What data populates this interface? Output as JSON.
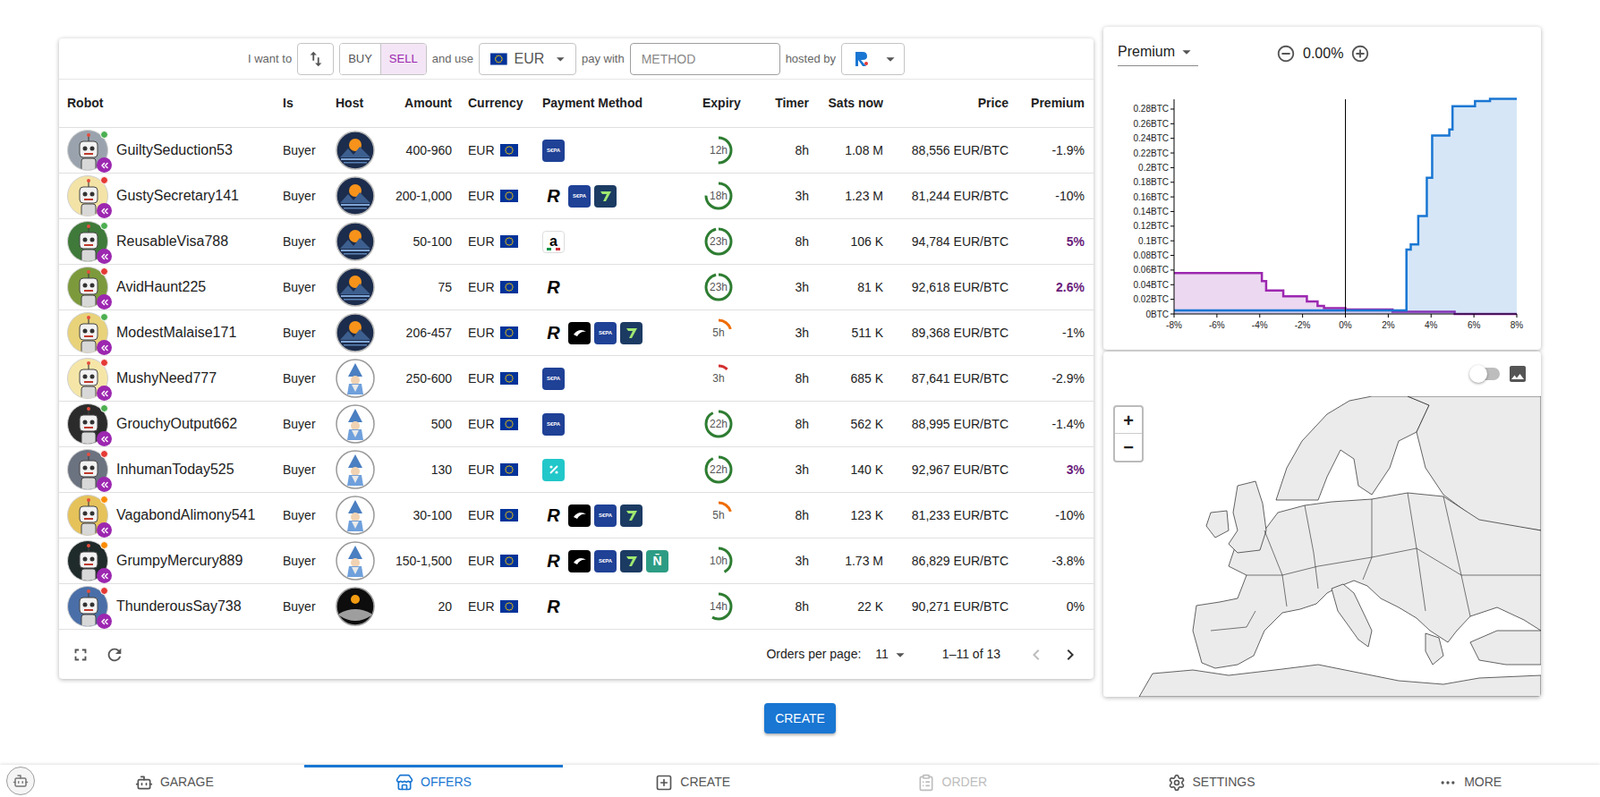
{
  "toolbar": {
    "want_label": "I want to",
    "side": [
      {
        "label": "BUY",
        "selected": false
      },
      {
        "label": "SELL",
        "selected": true
      }
    ],
    "use_label": "and use",
    "currency": "EUR",
    "pay_label": "pay with",
    "method_placeholder": "METHOD",
    "host_label": "hosted by"
  },
  "table": {
    "columns": [
      "Robot",
      "Is",
      "Host",
      "Amount",
      "Currency",
      "Payment Method",
      "Expiry",
      "Timer",
      "Sats now",
      "Price",
      "Premium"
    ],
    "rows": [
      {
        "robot": "GuiltySeduction53",
        "avatar_color": "#9aa3ad",
        "status_color": "#4caf50",
        "is": "Buyer",
        "host": "mountain",
        "amount": "400-960",
        "currency": "EUR",
        "methods": [
          {
            "kind": "sepa",
            "glyph": "S€PA"
          }
        ],
        "expiry": {
          "text": "12h",
          "level": 0.5,
          "color": "#2e7d32"
        },
        "timer": "8h",
        "sats": "1.08 M",
        "price": "88,556 EUR/BTC",
        "premium": {
          "text": "-1.9%",
          "highlight": false
        }
      },
      {
        "robot": "GustySecretary141",
        "avatar_color": "#f3e3a6",
        "status_color": "#e53935",
        "is": "Buyer",
        "host": "mountain",
        "amount": "200-1,000",
        "currency": "EUR",
        "methods": [
          {
            "kind": "revolut",
            "glyph": "R"
          },
          {
            "kind": "sepa",
            "glyph": "S€PA"
          },
          {
            "kind": "wise"
          }
        ],
        "expiry": {
          "text": "18h",
          "level": 0.75,
          "color": "#2e7d32"
        },
        "timer": "3h",
        "sats": "1.23 M",
        "price": "81,244 EUR/BTC",
        "premium": {
          "text": "-10%",
          "highlight": false
        }
      },
      {
        "robot": "ReusableVisa788",
        "avatar_color": "#3f7a3a",
        "status_color": "#4caf50",
        "is": "Buyer",
        "host": "mountain",
        "amount": "50-100",
        "currency": "EUR",
        "methods": [
          {
            "kind": "amazon",
            "glyph": "a"
          }
        ],
        "expiry": {
          "text": "23h",
          "level": 0.96,
          "color": "#2e7d32"
        },
        "timer": "8h",
        "sats": "106 K",
        "price": "94,784 EUR/BTC",
        "premium": {
          "text": "5%",
          "highlight": true
        }
      },
      {
        "robot": "AvidHaunt225",
        "avatar_color": "#7c9a3c",
        "status_color": "#e53935",
        "is": "Buyer",
        "host": "mountain",
        "amount": "75",
        "currency": "EUR",
        "methods": [
          {
            "kind": "revolut",
            "glyph": "R"
          }
        ],
        "expiry": {
          "text": "23h",
          "level": 0.96,
          "color": "#2e7d32"
        },
        "timer": "3h",
        "sats": "81 K",
        "price": "92,618 EUR/BTC",
        "premium": {
          "text": "2.6%",
          "highlight": true
        }
      },
      {
        "robot": "ModestMalaise171",
        "avatar_color": "#e8d27a",
        "status_color": "#4caf50",
        "is": "Buyer",
        "host": "mountain",
        "amount": "206-457",
        "currency": "EUR",
        "methods": [
          {
            "kind": "revolut",
            "glyph": "R"
          },
          {
            "kind": "swoosh"
          },
          {
            "kind": "sepa",
            "glyph": "S€PA"
          },
          {
            "kind": "wise"
          }
        ],
        "expiry": {
          "text": "5h",
          "level": 0.2,
          "color": "#ef6c00"
        },
        "timer": "3h",
        "sats": "511 K",
        "price": "89,368 EUR/BTC",
        "premium": {
          "text": "-1%",
          "highlight": false
        }
      },
      {
        "robot": "MushyNeed777",
        "avatar_color": "#f5e6a8",
        "status_color": "#e53935",
        "is": "Buyer",
        "host": "wizard",
        "amount": "250-600",
        "currency": "EUR",
        "methods": [
          {
            "kind": "sepa",
            "glyph": "S€PA"
          }
        ],
        "expiry": {
          "text": "3h",
          "level": 0.12,
          "color": "#d32f2f"
        },
        "timer": "8h",
        "sats": "685 K",
        "price": "87,641 EUR/BTC",
        "premium": {
          "text": "-2.9%",
          "highlight": false
        }
      },
      {
        "robot": "GrouchyOutput662",
        "avatar_color": "#2b2b2b",
        "status_color": "#4caf50",
        "is": "Buyer",
        "host": "wizard",
        "amount": "500",
        "currency": "EUR",
        "methods": [
          {
            "kind": "sepa",
            "glyph": "S€PA"
          }
        ],
        "expiry": {
          "text": "22h",
          "level": 0.92,
          "color": "#2e7d32"
        },
        "timer": "8h",
        "sats": "562 K",
        "price": "88,995 EUR/BTC",
        "premium": {
          "text": "-1.4%",
          "highlight": false
        }
      },
      {
        "robot": "InhumanToday525",
        "avatar_color": "#6b7280",
        "status_color": "#e53935",
        "is": "Buyer",
        "host": "wizard",
        "amount": "130",
        "currency": "EUR",
        "methods": [
          {
            "kind": "percent"
          }
        ],
        "expiry": {
          "text": "22h",
          "level": 0.92,
          "color": "#2e7d32"
        },
        "timer": "3h",
        "sats": "140 K",
        "price": "92,967 EUR/BTC",
        "premium": {
          "text": "3%",
          "highlight": true
        }
      },
      {
        "robot": "VagabondAlimony541",
        "avatar_color": "#e6c25a",
        "status_color": "#fb8c00",
        "is": "Buyer",
        "host": "wizard",
        "amount": "30-100",
        "currency": "EUR",
        "methods": [
          {
            "kind": "revolut",
            "glyph": "R"
          },
          {
            "kind": "swoosh"
          },
          {
            "kind": "sepa",
            "glyph": "S€PA"
          },
          {
            "kind": "wise"
          }
        ],
        "expiry": {
          "text": "5h",
          "level": 0.2,
          "color": "#ef6c00"
        },
        "timer": "8h",
        "sats": "123 K",
        "price": "81,233 EUR/BTC",
        "premium": {
          "text": "-10%",
          "highlight": false
        }
      },
      {
        "robot": "GrumpyMercury889",
        "avatar_color": "#1f2a2a",
        "status_color": "#fb8c00",
        "is": "Buyer",
        "host": "wizard",
        "amount": "150-1,500",
        "currency": "EUR",
        "methods": [
          {
            "kind": "revolut",
            "glyph": "R"
          },
          {
            "kind": "swoosh"
          },
          {
            "kind": "sepa",
            "glyph": "S€PA"
          },
          {
            "kind": "wise"
          },
          {
            "kind": "nbar",
            "glyph": "N̄"
          }
        ],
        "expiry": {
          "text": "10h",
          "level": 0.42,
          "color": "#2e7d32"
        },
        "timer": "3h",
        "sats": "1.73 M",
        "price": "86,829 EUR/BTC",
        "premium": {
          "text": "-3.8%",
          "highlight": false
        }
      },
      {
        "robot": "ThunderousSay738",
        "avatar_color": "#4a6fa8",
        "status_color": "#e53935",
        "is": "Buyer",
        "host": "moon",
        "amount": "20",
        "currency": "EUR",
        "methods": [
          {
            "kind": "revolut",
            "glyph": "R"
          }
        ],
        "expiry": {
          "text": "14h",
          "level": 0.58,
          "color": "#2e7d32"
        },
        "timer": "8h",
        "sats": "22 K",
        "price": "90,271 EUR/BTC",
        "premium": {
          "text": "0%",
          "highlight": false
        }
      }
    ]
  },
  "footer": {
    "per_page_label": "Orders per page:",
    "per_page": "11",
    "range": "1–11 of 13",
    "prev_disabled": true,
    "next_disabled": false
  },
  "create_button": "CREATE",
  "chart": {
    "mode": "Premium",
    "premium": "0.00%",
    "y_ticks": [
      "0.28BTC",
      "0.26BTC",
      "0.24BTC",
      "0.22BTC",
      "0.2BTC",
      "0.18BTC",
      "0.16BTC",
      "0.14BTC",
      "0.12BTC",
      "0.1BTC",
      "0.08BTC",
      "0.06BTC",
      "0.04BTC",
      "0.02BTC",
      "0BTC"
    ],
    "x_ticks": [
      "-8%",
      "-6%",
      "-4%",
      "-2%",
      "0%",
      "2%",
      "4%",
      "6%",
      "8%"
    ],
    "series": [
      {
        "color": "#9c27b0",
        "x": [
          -8,
          -3.9,
          -3.7,
          -2.9,
          -1.8,
          -1.3,
          -1,
          0,
          2.2,
          5.1
        ],
        "y": [
          0.056,
          0.045,
          0.032,
          0.024,
          0.017,
          0.011,
          0.008,
          0.006,
          0.003,
          0
        ]
      },
      {
        "color": "#1976d2",
        "x": [
          -8,
          2.85,
          3.05,
          3.4,
          3.8,
          4.05,
          4.85,
          5.0,
          6.05,
          6.75
        ],
        "y": [
          0.005,
          0.088,
          0.095,
          0.134,
          0.186,
          0.244,
          0.252,
          0.284,
          0.291,
          0.294
        ]
      }
    ]
  },
  "map": {
    "zoom_in": "+",
    "zoom_out": "−",
    "toggle_on": false
  },
  "nav": [
    {
      "label": "GARAGE",
      "selected": false,
      "disabled": false
    },
    {
      "label": "OFFERS",
      "selected": true,
      "disabled": false
    },
    {
      "label": "CREATE",
      "selected": false,
      "disabled": false
    },
    {
      "label": "ORDER",
      "selected": false,
      "disabled": true
    },
    {
      "label": "SETTINGS",
      "selected": false,
      "disabled": false
    },
    {
      "label": "MORE",
      "selected": false,
      "disabled": false
    }
  ]
}
